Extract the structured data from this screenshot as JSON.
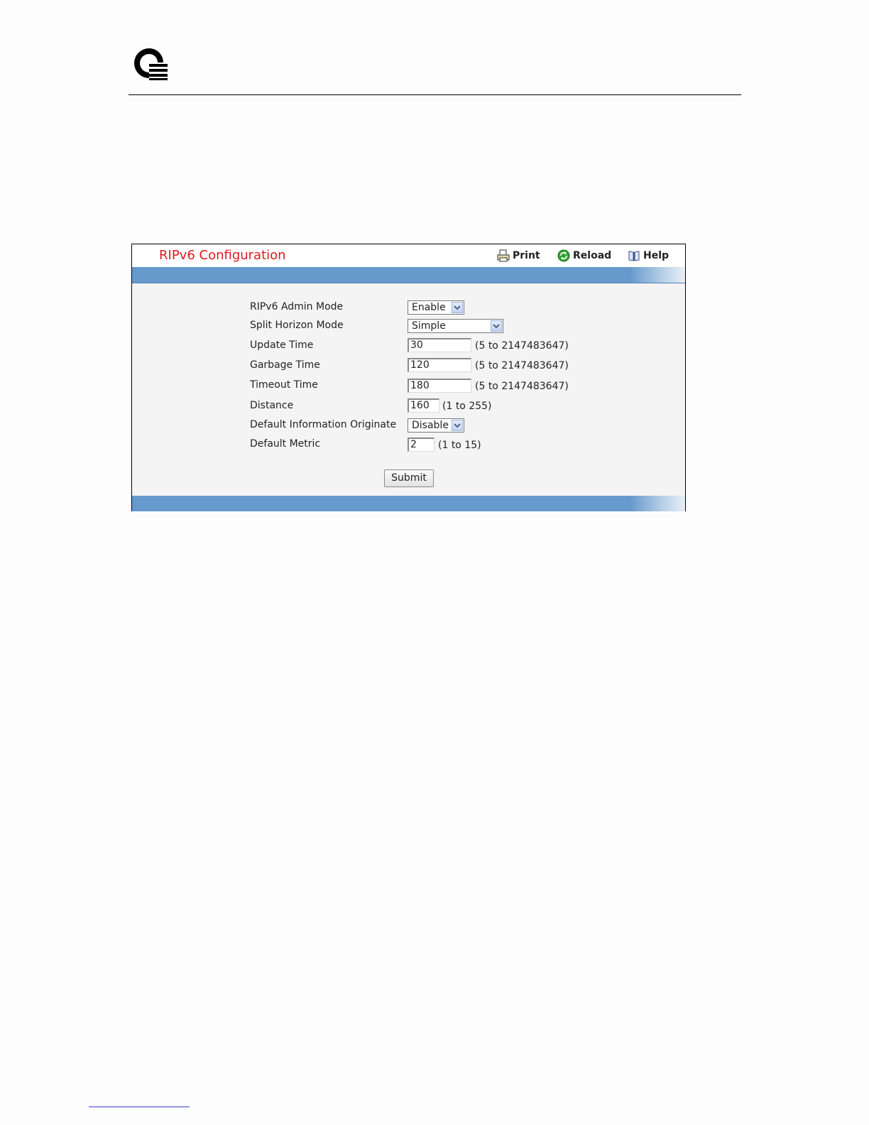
{
  "panel": {
    "title": "RIPv6 Configuration",
    "tools": {
      "print": "Print",
      "reload": "Reload",
      "help": "Help"
    }
  },
  "form": {
    "admin_mode": {
      "label": "RIPv6 Admin Mode",
      "value": "Enable"
    },
    "split_horizon": {
      "label": "Split Horizon Mode",
      "value": "Simple"
    },
    "update_time": {
      "label": "Update Time",
      "value": "30",
      "range": "(5 to 2147483647)"
    },
    "garbage_time": {
      "label": "Garbage Time",
      "value": "120",
      "range": "(5 to 2147483647)"
    },
    "timeout_time": {
      "label": "Timeout Time",
      "value": "180",
      "range": "(5 to 2147483647)"
    },
    "distance": {
      "label": "Distance",
      "value": "160",
      "range": "(1 to 255)"
    },
    "default_info_originate": {
      "label": "Default Information Originate",
      "value": "Disable"
    },
    "default_metric": {
      "label": "Default Metric",
      "value": "2",
      "range": "(1 to 15)"
    },
    "submit_label": "Submit"
  },
  "colors": {
    "title_red": "#e0191f",
    "bar_blue": "#6699cc",
    "panel_bg": "#f4f4f4"
  }
}
